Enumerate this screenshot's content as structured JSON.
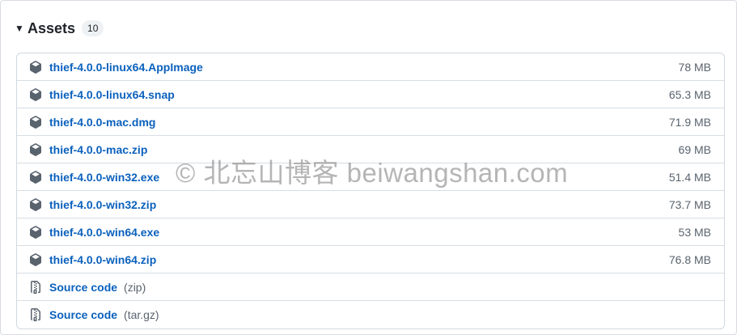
{
  "assets": {
    "title": "Assets",
    "count": "10",
    "files": [
      {
        "name": "thief-4.0.0-linux64.AppImage",
        "size": "78 MB"
      },
      {
        "name": "thief-4.0.0-linux64.snap",
        "size": "65.3 MB"
      },
      {
        "name": "thief-4.0.0-mac.dmg",
        "size": "71.9 MB"
      },
      {
        "name": "thief-4.0.0-mac.zip",
        "size": "69 MB"
      },
      {
        "name": "thief-4.0.0-win32.exe",
        "size": "51.4 MB"
      },
      {
        "name": "thief-4.0.0-win32.zip",
        "size": "73.7 MB"
      },
      {
        "name": "thief-4.0.0-win64.exe",
        "size": "53 MB"
      },
      {
        "name": "thief-4.0.0-win64.zip",
        "size": "76.8 MB"
      }
    ],
    "source": [
      {
        "label": "Source code",
        "format": "(zip)"
      },
      {
        "label": "Source code",
        "format": "(tar.gz)"
      }
    ]
  },
  "icons": {
    "package": "package-icon",
    "file_zip": "file-zip-icon",
    "caret": "triangle-down-icon"
  },
  "colors": {
    "link": "#0b61bd",
    "muted": "#59636e",
    "border": "#d1d9e0"
  },
  "watermark": "© 北忘山博客 beiwangshan.com"
}
